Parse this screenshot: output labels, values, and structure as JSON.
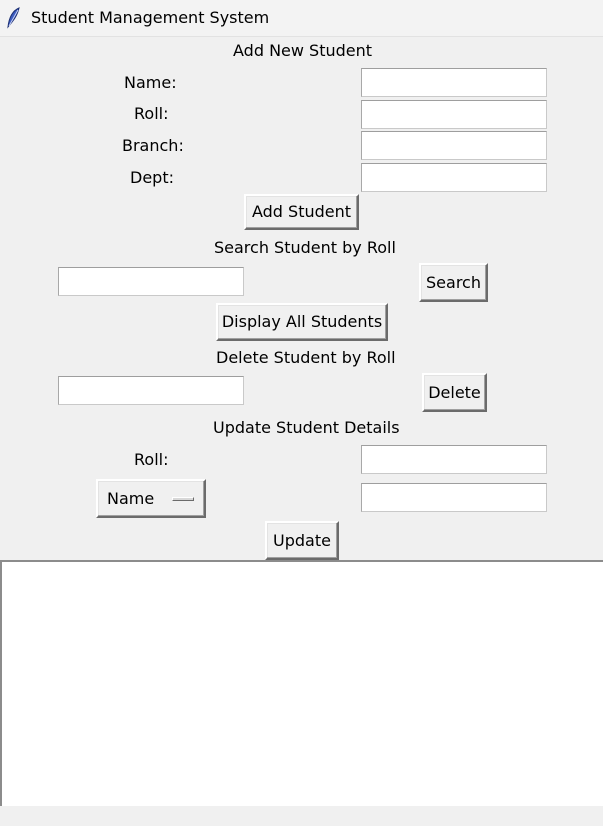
{
  "window": {
    "title": "Student Management System",
    "icon": "feather-icon"
  },
  "add_section": {
    "heading": "Add New Student",
    "name_label": "Name:",
    "roll_label": "Roll:",
    "branch_label": "Branch:",
    "dept_label": "Dept:",
    "name_value": "",
    "roll_value": "",
    "branch_value": "",
    "dept_value": "",
    "add_button": "Add Student"
  },
  "search_section": {
    "heading": "Search Student by Roll",
    "roll_value": "",
    "search_button": "Search"
  },
  "display_button": "Display All Students",
  "delete_section": {
    "heading": "Delete Student by Roll",
    "roll_value": "",
    "delete_button": "Delete"
  },
  "update_section": {
    "heading": "Update Student Details",
    "roll_label": "Roll:",
    "roll_value": "",
    "field_selected": "Name",
    "new_value": "",
    "update_button": "Update"
  },
  "output": {
    "text": ""
  }
}
